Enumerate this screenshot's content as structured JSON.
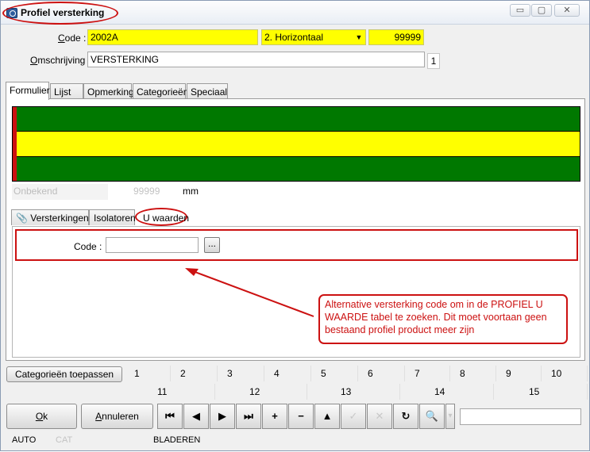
{
  "window": {
    "title": "Profiel versterking",
    "controls": {
      "minimize": "▭",
      "maximize": "▢",
      "close": "✕"
    }
  },
  "form": {
    "code_label_prefix": "C",
    "code_label_rest": "ode :",
    "code_value": "2002A",
    "direction_value": "2. Horizontaal",
    "number_value": "99999",
    "description_label_prefix": "O",
    "description_label_rest": "mschrijving :",
    "description_value": "VERSTERKING",
    "counter": "1"
  },
  "tabs": [
    "Formulier",
    "Lijst",
    "Opmerking",
    "Categorieën",
    "Speciaal"
  ],
  "profile": {
    "unknown_label": "Onbekend",
    "size_value": "99999",
    "unit": "mm",
    "colors": {
      "green": "#007800",
      "yellow": "#ffff00",
      "red": "#cc1111"
    }
  },
  "subtabs": [
    "Versterkingen",
    "Isolatoren",
    "U waarden"
  ],
  "u_values": {
    "code_label": "Code :",
    "code_value": "",
    "browse_label": "..."
  },
  "annotation": {
    "text": "Alternative versterking code om in de PROFIEL U WAARDE tabel te zoeken. Dit moet voortaan geen bestaand profiel product meer zijn"
  },
  "categories": {
    "apply_label": "Categorieën toepassen",
    "row1": [
      "1",
      "2",
      "3",
      "4",
      "5",
      "6",
      "7",
      "8",
      "9",
      "10"
    ],
    "row2": [
      "11",
      "12",
      "13",
      "14",
      "15"
    ]
  },
  "toolbar": {
    "ok_prefix": "O",
    "ok_rest": "k",
    "cancel_prefix": "A",
    "cancel_rest": "nnuleren",
    "first": "⏮",
    "prev": "◀",
    "next": "▶",
    "last": "⏭",
    "add": "+",
    "remove": "−",
    "up": "▲",
    "confirm": "✓",
    "discard": "✕",
    "refresh": "↻",
    "find": "🔍",
    "dropdown": "▾",
    "search_value": ""
  },
  "status": {
    "mode": "AUTO",
    "cat": "CAT",
    "state": "BLADEREN"
  }
}
